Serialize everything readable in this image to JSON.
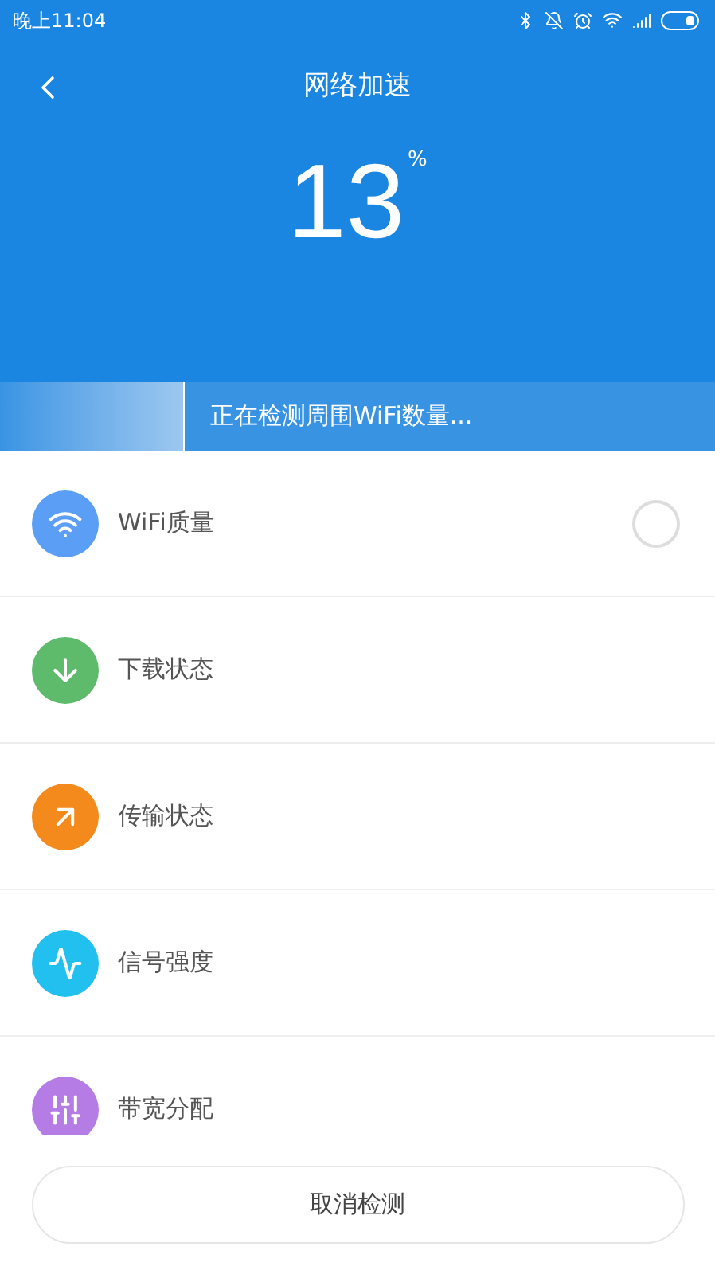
{
  "status_bar": {
    "time": "晚上11:04"
  },
  "header": {
    "title": "网络加速",
    "percent": "13",
    "percent_sign": "%"
  },
  "scan_banner": {
    "text": "正在检测周围WiFi数量..."
  },
  "checks": [
    {
      "label": "WiFi质量",
      "color": "#5a9ef5",
      "checking": true
    },
    {
      "label": "下载状态",
      "color": "#5dbb6b",
      "checking": false
    },
    {
      "label": "传输状态",
      "color": "#f48a1c",
      "checking": false
    },
    {
      "label": "信号强度",
      "color": "#22c0ee",
      "checking": false
    },
    {
      "label": "带宽分配",
      "color": "#b67ce6",
      "checking": false
    }
  ],
  "cancel_button": {
    "label": "取消检测"
  }
}
